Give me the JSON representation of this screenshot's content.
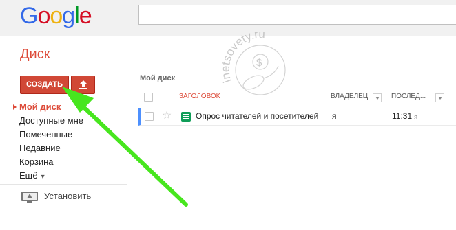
{
  "brand": {
    "logo_letters": [
      "G",
      "o",
      "o",
      "g",
      "l",
      "e"
    ]
  },
  "search": {
    "value": ""
  },
  "app": {
    "title": "Диск"
  },
  "toolbar": {
    "create_label": "СОЗДАТЬ",
    "upload_icon": "upload-icon"
  },
  "sidebar": {
    "items": [
      {
        "label": "Мой диск",
        "active": true
      },
      {
        "label": "Доступные мне"
      },
      {
        "label": "Помеченные"
      },
      {
        "label": "Недавние"
      },
      {
        "label": "Корзина"
      },
      {
        "label": "Ещё"
      }
    ],
    "install_label": "Установить"
  },
  "main": {
    "breadcrumb": "Мой диск",
    "columns": {
      "title": "ЗАГОЛОВОК",
      "owner": "ВЛАДЕЛЕЦ",
      "modified": "ПОСЛЕД..."
    },
    "rows": [
      {
        "name": "Опрос читателей и посетителей",
        "owner": "я",
        "time": "11:31",
        "by": "я"
      }
    ]
  },
  "watermark": {
    "text": "inetsovety.ru"
  },
  "colors": {
    "accent": "#dd4b39",
    "button": "#d14836",
    "arrow": "#47e61e",
    "select": "#4d90fe"
  }
}
